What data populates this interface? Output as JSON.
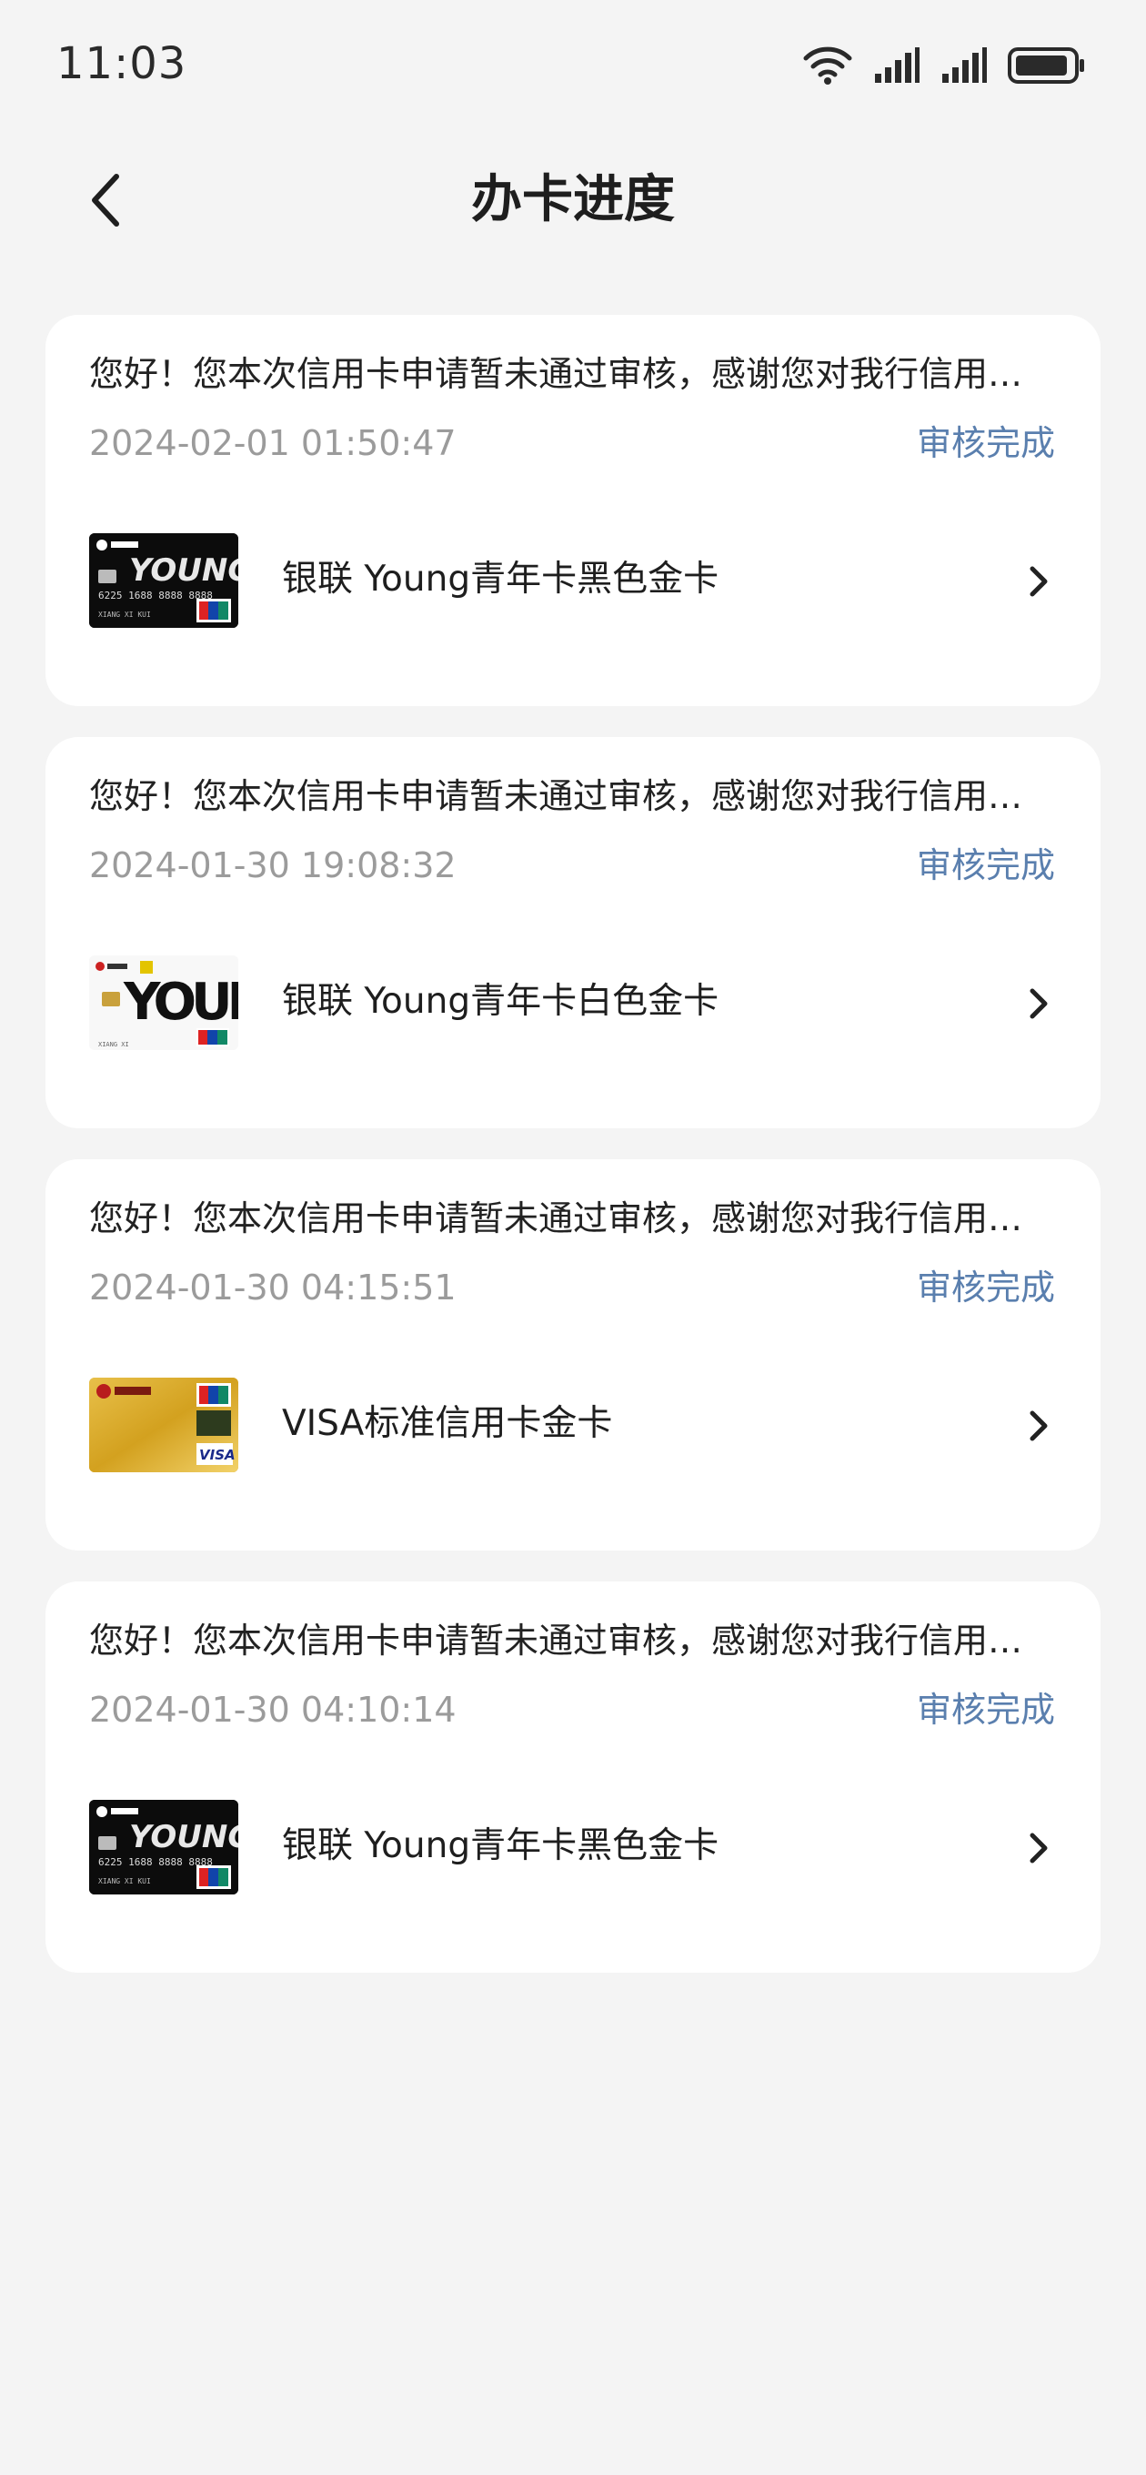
{
  "status_bar": {
    "time": "11:03"
  },
  "nav": {
    "title": "办卡进度"
  },
  "applications": [
    {
      "message": "您好！您本次信用卡申请暂未通过审核，感谢您对我行信用…",
      "time": "2024-02-01 01:50:47",
      "status": "审核完成",
      "card_name": "银联 Young青年卡黑色金卡",
      "card_style": "black"
    },
    {
      "message": "您好！您本次信用卡申请暂未通过审核，感谢您对我行信用…",
      "time": "2024-01-30 19:08:32",
      "status": "审核完成",
      "card_name": "银联 Young青年卡白色金卡",
      "card_style": "white"
    },
    {
      "message": "您好！您本次信用卡申请暂未通过审核，感谢您对我行信用…",
      "time": "2024-01-30 04:15:51",
      "status": "审核完成",
      "card_name": "VISA标准信用卡金卡",
      "card_style": "gold"
    },
    {
      "message": "您好！您本次信用卡申请暂未通过审核，感谢您对我行信用…",
      "time": "2024-01-30 04:10:14",
      "status": "审核完成",
      "card_name": "银联 Young青年卡黑色金卡",
      "card_style": "black"
    }
  ],
  "colors": {
    "accent": "#5a7fae",
    "background": "#f4f4f4",
    "card": "#ffffff",
    "secondary_text": "#9b9b9b"
  },
  "icons": [
    "wifi-icon",
    "signal-icon",
    "battery-icon",
    "back-arrow-icon",
    "chevron-right-icon"
  ]
}
